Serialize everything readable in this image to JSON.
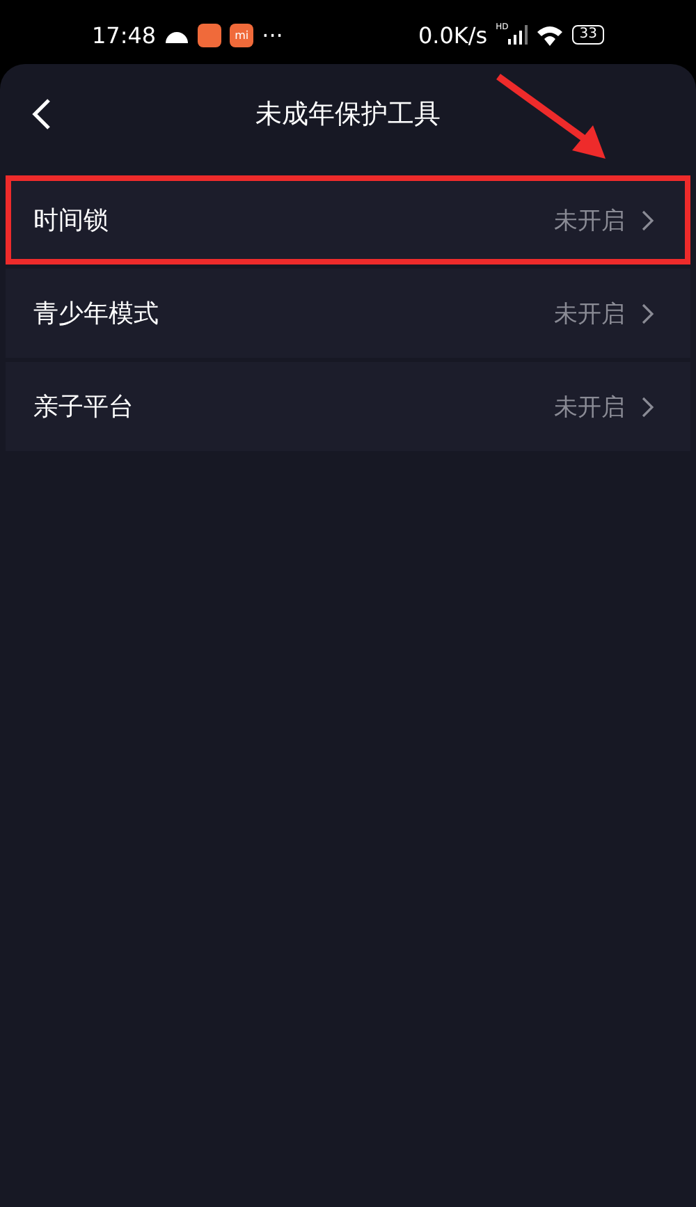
{
  "status_bar": {
    "time": "17:48",
    "app_badge": "mi",
    "more": "···",
    "net_speed": "0.0K/s",
    "signal_label": "HD",
    "battery": "33"
  },
  "header": {
    "title": "未成年保护工具"
  },
  "rows": [
    {
      "label": "时间锁",
      "status": "未开启",
      "highlighted": true
    },
    {
      "label": "青少年模式",
      "status": "未开启",
      "highlighted": false
    },
    {
      "label": "亲子平台",
      "status": "未开启",
      "highlighted": false
    }
  ]
}
